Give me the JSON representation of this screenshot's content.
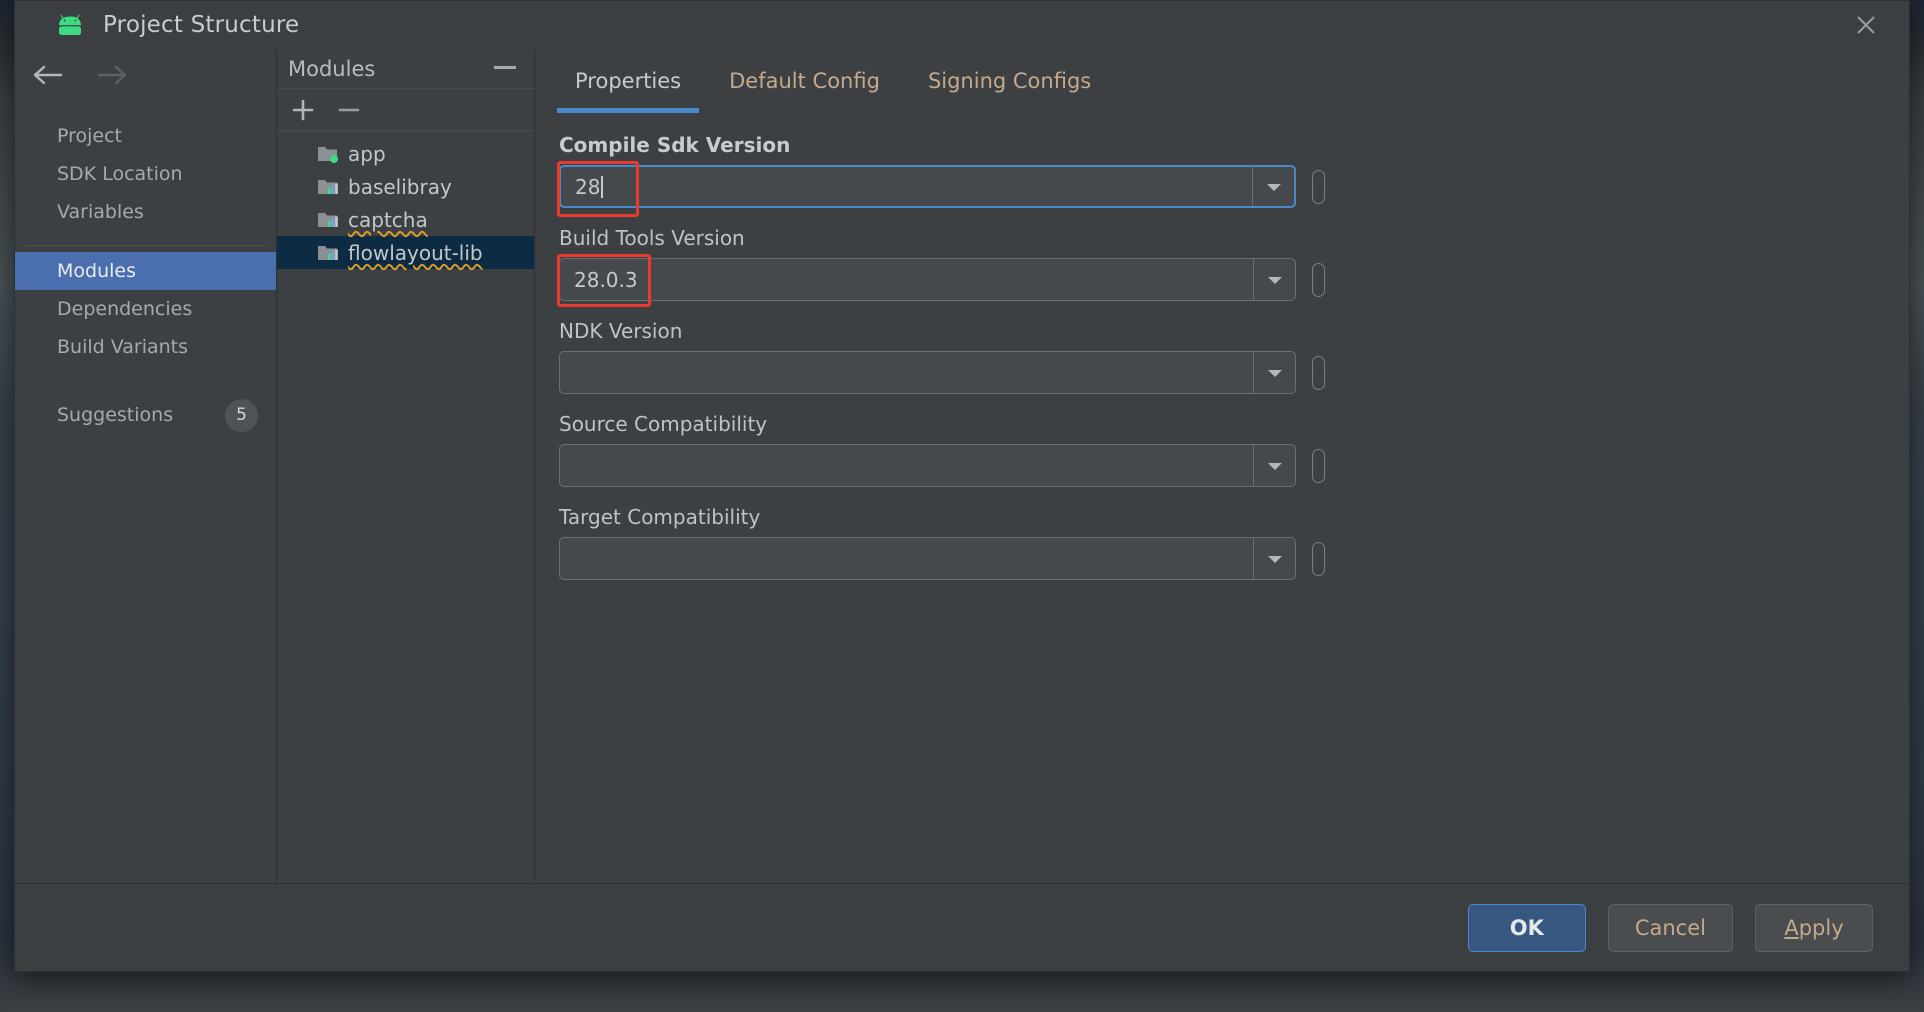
{
  "window": {
    "title": "Project Structure",
    "app_icon": "android-robot-icon",
    "close_icon": "close-icon"
  },
  "nav": {
    "back_icon": "arrow-left-icon",
    "forward_icon": "arrow-right-icon"
  },
  "sidebar": {
    "items": [
      {
        "label": "Project",
        "selected": false
      },
      {
        "label": "SDK Location",
        "selected": false
      },
      {
        "label": "Variables",
        "selected": false
      },
      {
        "label": "Modules",
        "selected": true
      },
      {
        "label": "Dependencies",
        "selected": false
      },
      {
        "label": "Build Variants",
        "selected": false
      },
      {
        "label": "Suggestions",
        "selected": false,
        "badge": "5"
      }
    ]
  },
  "modules_panel": {
    "title": "Modules",
    "collapse_icon": "minimize-icon",
    "add_icon": "plus-icon",
    "remove_icon": "minus-icon",
    "items": [
      {
        "label": "app",
        "icon": "application-module-icon",
        "selected": false,
        "misspelled": false
      },
      {
        "label": "baselibray",
        "icon": "library-module-icon",
        "selected": false,
        "misspelled": false
      },
      {
        "label": "captcha",
        "icon": "library-module-icon",
        "selected": false,
        "misspelled": true
      },
      {
        "label": "flowlayout-lib",
        "icon": "library-module-icon",
        "selected": true,
        "misspelled": true
      }
    ]
  },
  "content": {
    "tabs": [
      {
        "label": "Properties",
        "active": true
      },
      {
        "label": "Default Config",
        "active": false
      },
      {
        "label": "Signing Configs",
        "active": false
      }
    ],
    "fields": [
      {
        "label": "Compile Sdk Version",
        "value": "28",
        "bold_label": true,
        "focused": true,
        "annotated": true,
        "caret": true,
        "anno_width": 78
      },
      {
        "label": "Build Tools Version",
        "value": "28.0.3",
        "bold_label": false,
        "focused": false,
        "annotated": true,
        "caret": false,
        "anno_width": 93
      },
      {
        "label": "NDK Version",
        "value": "",
        "bold_label": false,
        "focused": false,
        "annotated": false,
        "caret": false,
        "anno_width": 0
      },
      {
        "label": "Source Compatibility",
        "value": "",
        "bold_label": false,
        "focused": false,
        "annotated": false,
        "caret": false,
        "anno_width": 0
      },
      {
        "label": "Target Compatibility",
        "value": "",
        "bold_label": false,
        "focused": false,
        "annotated": false,
        "caret": false,
        "anno_width": 0
      }
    ]
  },
  "footer": {
    "buttons": [
      {
        "label": "OK",
        "style": "default",
        "mnemonic_index": -1
      },
      {
        "label": "Cancel",
        "style": "normal",
        "mnemonic_index": -1
      },
      {
        "label": "Apply",
        "style": "normal",
        "mnemonic_index": 0
      }
    ]
  },
  "colors": {
    "dialog_bg": "#3c4043",
    "titlebar_bg": "#3c3f41",
    "selection_blue": "#4b6eaf",
    "tree_selection": "#0d2b43",
    "accent_blue": "#4a88c7",
    "annotation_red": "#e83b2e",
    "tab_text": "#c6a98a",
    "default_button": "#365880",
    "android_green": "#3ddc84"
  }
}
